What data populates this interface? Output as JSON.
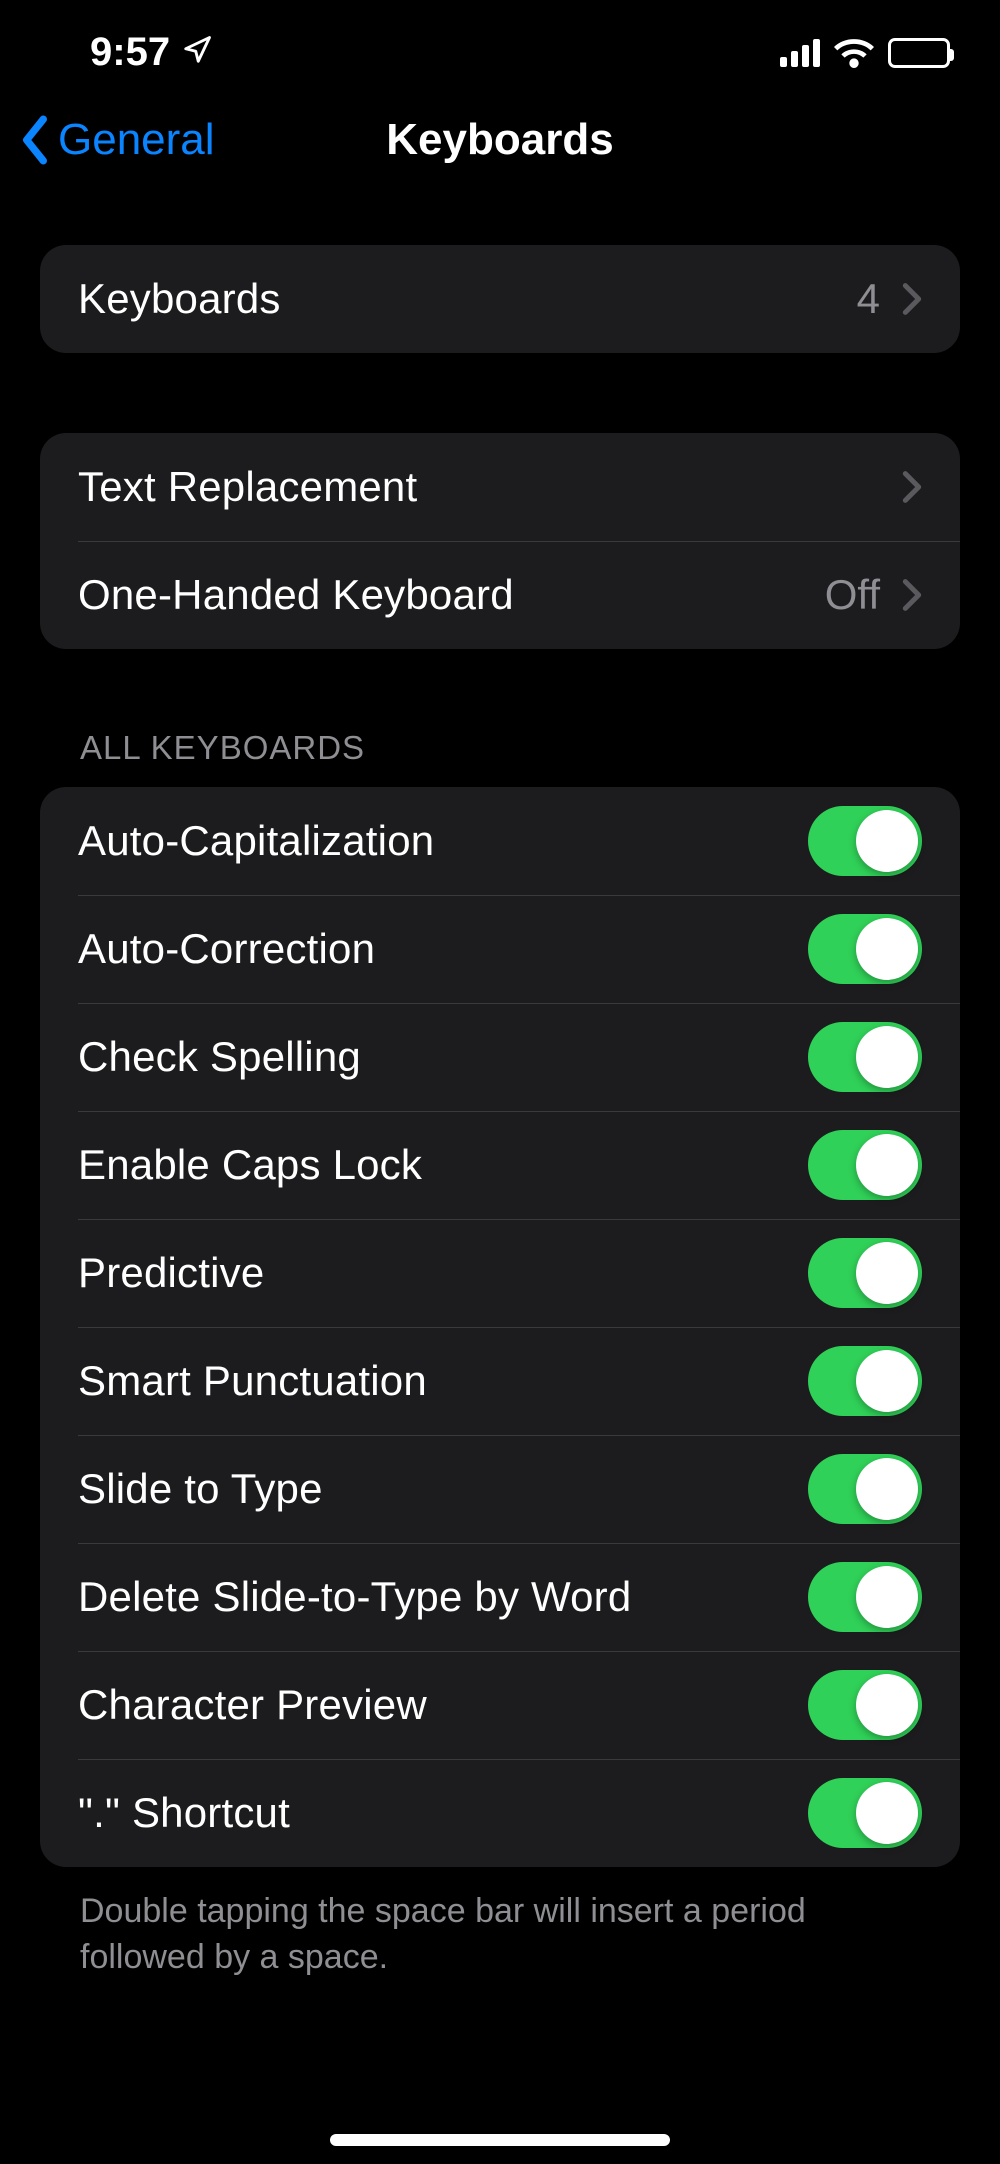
{
  "status": {
    "time": "9:57"
  },
  "nav": {
    "back_label": "General",
    "title": "Keyboards"
  },
  "group1": {
    "items": [
      {
        "label": "Keyboards",
        "value": "4"
      }
    ]
  },
  "group2": {
    "items": [
      {
        "label": "Text Replacement",
        "value": ""
      },
      {
        "label": "One-Handed Keyboard",
        "value": "Off"
      }
    ]
  },
  "group3": {
    "header": "ALL KEYBOARDS",
    "footer": "Double tapping the space bar will insert a period followed by a space.",
    "items": [
      {
        "label": "Auto-Capitalization",
        "on": true
      },
      {
        "label": "Auto-Correction",
        "on": true
      },
      {
        "label": "Check Spelling",
        "on": true
      },
      {
        "label": "Enable Caps Lock",
        "on": true
      },
      {
        "label": "Predictive",
        "on": true
      },
      {
        "label": "Smart Punctuation",
        "on": true
      },
      {
        "label": "Slide to Type",
        "on": true
      },
      {
        "label": "Delete Slide-to-Type by Word",
        "on": true
      },
      {
        "label": "Character Preview",
        "on": true
      },
      {
        "label": "\".\" Shortcut",
        "on": true
      }
    ]
  }
}
